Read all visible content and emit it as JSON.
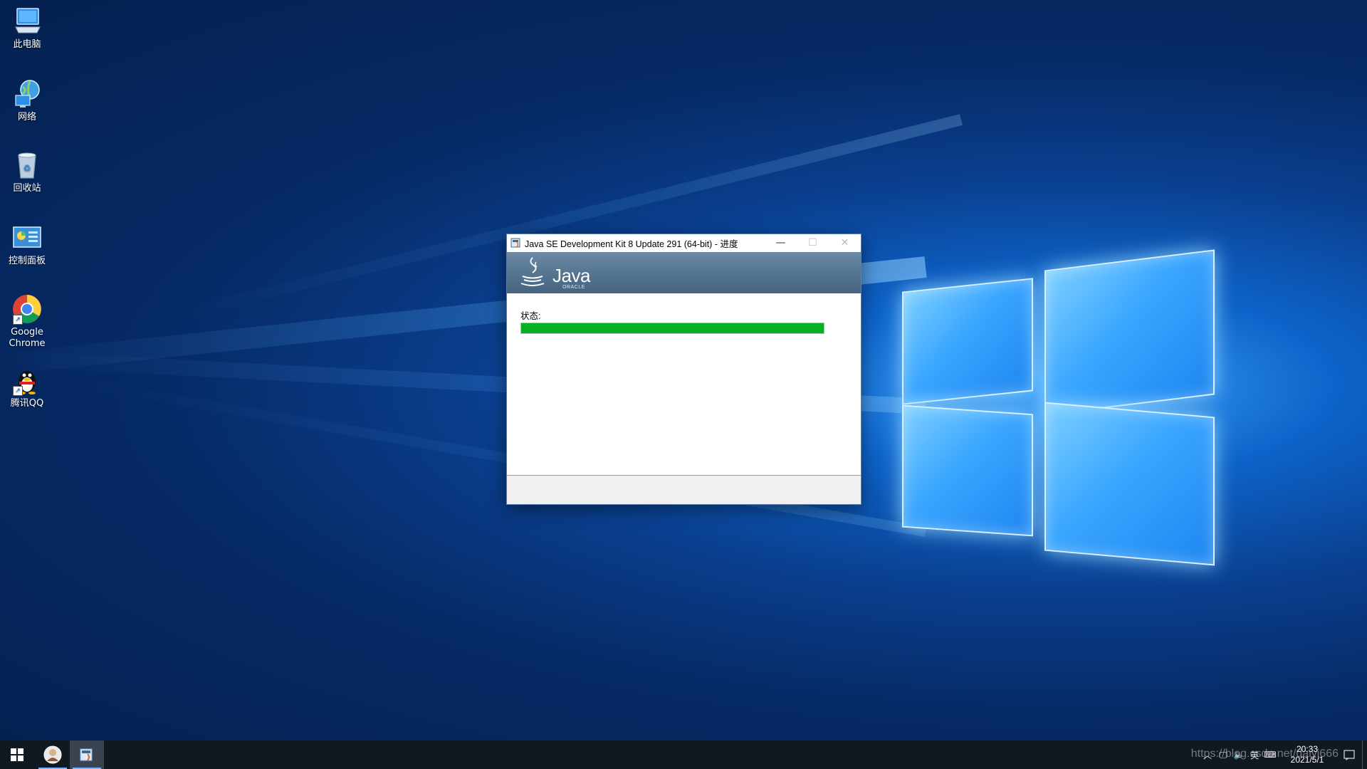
{
  "desktop": {
    "icons": [
      {
        "label": "此电脑",
        "icon": "this-pc-icon"
      },
      {
        "label": "网络",
        "icon": "network-icon"
      },
      {
        "label": "回收站",
        "icon": "recycle-bin-icon"
      },
      {
        "label": "控制面板",
        "icon": "control-panel-icon"
      },
      {
        "label": "Google\nChrome",
        "label_line1": "Google",
        "label_line2": "Chrome",
        "icon": "chrome-icon"
      },
      {
        "label": "腾讯QQ",
        "icon": "qq-icon"
      }
    ]
  },
  "installer": {
    "title": "Java SE Development Kit 8 Update 291 (64-bit) - 进度",
    "banner_logo_text": "Java",
    "banner_logo_sub": "ORACLE",
    "status_label": "状态:",
    "progress_fraction": 1.0,
    "progress_color": "#06b025",
    "buttons": {
      "minimize": "—",
      "maximize": "☐",
      "close": "✕"
    }
  },
  "taskbar": {
    "clock_time": "20:33",
    "clock_date": "2021/5/1",
    "ime_label": "英",
    "tray_icons": [
      "chevron-up-icon",
      "network-icon",
      "volume-icon",
      "ime-icon",
      "keyboard-icon"
    ],
    "apps": [
      {
        "name": "explorer-avatar-app",
        "active": false
      },
      {
        "name": "java-installer-app",
        "active": true
      }
    ]
  },
  "watermark": "https://blog.csdn.net/daiyi666",
  "colors": {
    "desktop_accent": "#0d63c9",
    "taskbar_bg": "#101820",
    "banner_bg": "#557591"
  }
}
